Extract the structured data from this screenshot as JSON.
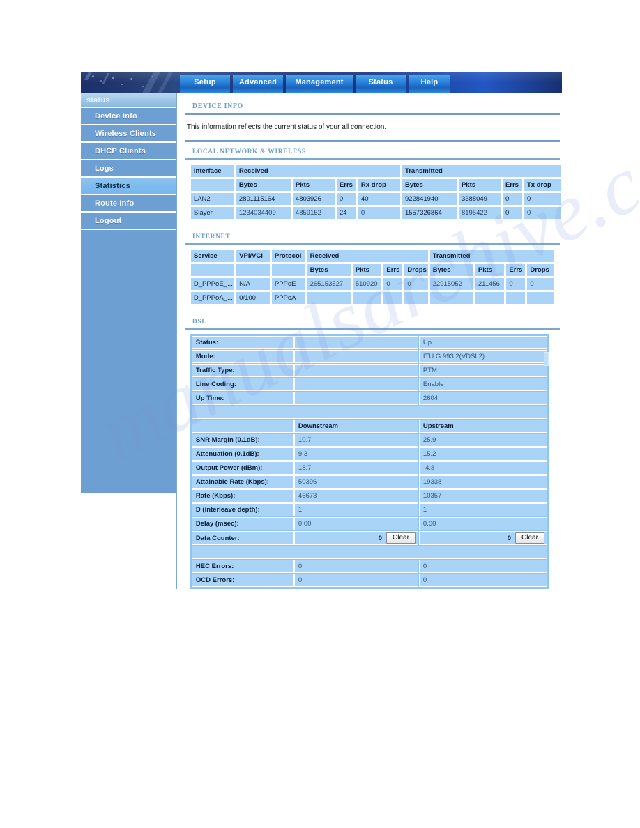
{
  "topnav": {
    "tabs": [
      {
        "label": "Setup"
      },
      {
        "label": "Advanced"
      },
      {
        "label": "Management"
      },
      {
        "label": "Status"
      },
      {
        "label": "Help"
      }
    ]
  },
  "sidebar": {
    "header": "status",
    "items": [
      {
        "label": "Device Info",
        "active": false
      },
      {
        "label": "Wireless Clients",
        "active": false
      },
      {
        "label": "DHCP Clients",
        "active": false
      },
      {
        "label": "Logs",
        "active": false
      },
      {
        "label": "Statistics",
        "active": true
      },
      {
        "label": "Route Info",
        "active": false
      },
      {
        "label": "Logout",
        "active": false
      }
    ]
  },
  "content": {
    "page_title": "DEVICE INFO",
    "intro": "This information reflects the current status of your all connection.",
    "sections": {
      "local": {
        "title": "LOCAL NETWORK & WIRELESS",
        "group_headers": {
          "interface": "Interface",
          "received": "Received",
          "transmitted": "Transmitted"
        },
        "sub_headers": [
          "",
          "Bytes",
          "Pkts",
          "Errs",
          "Rx drop",
          "Bytes",
          "Pkts",
          "Errs",
          "Tx drop"
        ],
        "rows": [
          {
            "interface": "LAN2",
            "rx_bytes": "2801115164",
            "rx_pkts": "4803926",
            "rx_errs": "0",
            "rx_drop": "40",
            "tx_bytes": "922841940",
            "tx_pkts": "3388049",
            "tx_errs": "0",
            "tx_drop": "0"
          },
          {
            "interface": "Slayer",
            "rx_bytes": "1234034409",
            "rx_pkts": "4859152",
            "rx_errs": "24",
            "rx_drop": "0",
            "tx_bytes": "1557326864",
            "tx_pkts": "8195422",
            "tx_errs": "0",
            "tx_drop": "0"
          }
        ]
      },
      "internet": {
        "title": "INTERNET",
        "group_headers": {
          "service": "Service",
          "vpi_vci": "VPI/VCI",
          "protocol": "Protocol",
          "received": "Received",
          "transmitted": "Transmitted"
        },
        "sub_headers": [
          "",
          "",
          "",
          "Bytes",
          "Pkts",
          "Errs",
          "Drops",
          "Bytes",
          "Pkts",
          "Errs",
          "Drops"
        ],
        "rows": [
          {
            "service": "D_PPPoE_...",
            "vpi_vci": "N/A",
            "protocol": "PPPoE",
            "rx_bytes": "265153527",
            "rx_pkts": "510920",
            "rx_errs": "0",
            "rx_drops": "0",
            "tx_bytes": "22915052",
            "tx_pkts": "211456",
            "tx_errs": "0",
            "tx_drops": "0"
          },
          {
            "service": "D_PPPoA_...",
            "vpi_vci": "0/100",
            "protocol": "PPPoA",
            "rx_bytes": "",
            "rx_pkts": "",
            "rx_errs": "",
            "rx_drops": "",
            "tx_bytes": "",
            "tx_pkts": "",
            "tx_errs": "",
            "tx_drops": ""
          }
        ]
      },
      "dsl": {
        "title": "DSL",
        "info_rows": [
          {
            "label": "Status:",
            "value": "Up"
          },
          {
            "label": "Mode:",
            "value": "ITU G.993.2(VDSL2)"
          },
          {
            "label": "Traffic Type:",
            "value": "PTM"
          },
          {
            "label": "Line Coding:",
            "value": "Enable"
          },
          {
            "label": "Up Time:",
            "value": "2604"
          }
        ],
        "direction_headers": {
          "downstream": "Downstream",
          "upstream": "Upstream"
        },
        "metric_rows": [
          {
            "label": "SNR Margin (0.1dB):",
            "downstream": "10.7",
            "upstream": "25.9"
          },
          {
            "label": "Attenuation (0.1dB):",
            "downstream": "9.3",
            "upstream": "15.2"
          },
          {
            "label": "Output Power (dBm):",
            "downstream": "18.7",
            "upstream": "-4.8"
          },
          {
            "label": "Attainable Rate (Kbps):",
            "downstream": "50396",
            "upstream": "19338"
          },
          {
            "label": "Rate (Kbps):",
            "downstream": "46673",
            "upstream": "10357"
          },
          {
            "label": "D (interleave depth):",
            "downstream": "1",
            "upstream": "1"
          },
          {
            "label": "Delay (msec):",
            "downstream": "0.00",
            "upstream": "0.00"
          }
        ],
        "data_counter": {
          "label": "Data Counter:",
          "downstream_value": "0",
          "downstream_button": "Clear",
          "upstream_value": "0",
          "upstream_button": "Clear"
        },
        "error_rows": [
          {
            "label": "HEC Errors:",
            "downstream": "0",
            "upstream": "0"
          },
          {
            "label": "OCD Errors:",
            "downstream": "0",
            "upstream": "0"
          }
        ]
      }
    }
  },
  "watermark": {
    "text": "manualsarchive.com"
  },
  "colors": {
    "banner_dark_blue": "#1b2f6b",
    "tab_blue": "#2b84da",
    "sidebar_blue": "#6e9fd2",
    "table_cell_blue": "#a9d3f7",
    "section_title_blue": "#6c9ecb",
    "rule_blue": "#6e9ec6"
  }
}
